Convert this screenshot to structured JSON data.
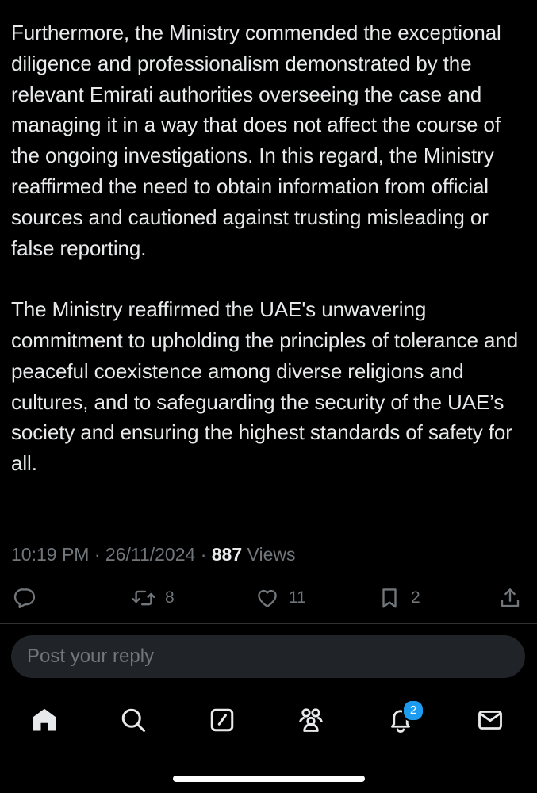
{
  "tweet": {
    "paragraph_1": "Furthermore, the Ministry commended the exceptional diligence and professionalism demonstrated by the relevant Emirati authorities overseeing the case and managing it in a way that does not affect the course of the ongoing investigations. In this regard, the Ministry reaffirmed the need to obtain information from official sources and cautioned against trusting misleading or false reporting.",
    "paragraph_2": "The Ministry reaffirmed the UAE's unwavering commitment to upholding the principles of tolerance and peaceful coexistence among diverse religions and cultures, and to safeguarding the security of the UAE’s society and ensuring the highest standards of safety for all."
  },
  "meta": {
    "time": "10:19 PM",
    "separator": "·",
    "date": "26/11/2024",
    "views_count": "887",
    "views_label": "Views"
  },
  "actions": {
    "reply_icon": "reply-icon",
    "repost_icon": "repost-icon",
    "repost_count": "8",
    "like_icon": "heart-icon",
    "like_count": "11",
    "bookmark_icon": "bookmark-icon",
    "bookmark_count": "2",
    "share_icon": "share-icon"
  },
  "reply": {
    "placeholder": "Post your reply"
  },
  "tabbar": {
    "items": [
      "home-icon",
      "search-icon",
      "compose-icon",
      "communities-icon",
      "notifications-icon",
      "messages-icon"
    ],
    "notifications_badge": "2"
  },
  "colors": {
    "background": "#000000",
    "text": "#e7e9ea",
    "secondary": "#71767b",
    "reply_box": "#202327",
    "badge": "#1d9bf0"
  }
}
